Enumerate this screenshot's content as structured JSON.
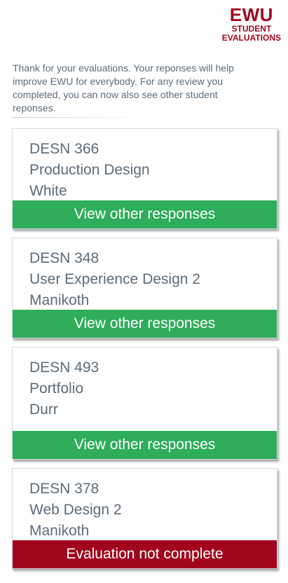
{
  "logo": {
    "main": "EWU",
    "line1": "STUDENT",
    "line2": "EVALUATIONS"
  },
  "intro": "Thank for your evaluations. Your reponses will help improve EWU for everybody. For any review you completed, you can now also see other student reponses.",
  "colors": {
    "accent": "#a1051d",
    "success": "#2fad5b",
    "text": "#5d6b78"
  },
  "courses": [
    {
      "code": "DESN 366",
      "title": "Production Design",
      "instructor": "White",
      "action": "View other responses",
      "status": "complete"
    },
    {
      "code": "DESN 348",
      "title": "User Experience Design 2",
      "instructor": "Manikoth",
      "action": "View other responses",
      "status": "complete"
    },
    {
      "code": "DESN 493",
      "title": "Portfolio",
      "instructor": "Durr",
      "action": "View other responses",
      "status": "complete"
    },
    {
      "code": "DESN 378",
      "title": "Web Design 2",
      "instructor": "Manikoth",
      "action": "Evaluation not complete",
      "status": "incomplete"
    }
  ]
}
